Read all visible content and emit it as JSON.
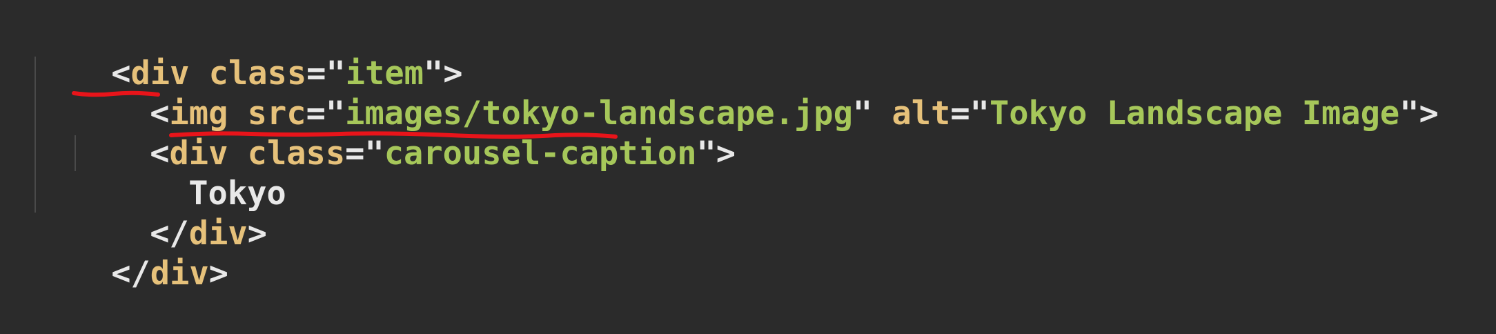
{
  "editor": {
    "line1": {
      "open": "<",
      "tag": "div",
      "attr": "class",
      "eq": "=",
      "q1": "\"",
      "value": "item",
      "q2": "\"",
      "close": ">"
    },
    "line2": {
      "open": "<",
      "tag": "img",
      "attr1": "src",
      "eq1": "=",
      "q1": "\"",
      "value1": "images/tokyo-landscape.jpg",
      "q2": "\"",
      "attr2": "alt",
      "eq2": "=",
      "q3": "\"",
      "value2": "Tokyo Landscape Image",
      "q4": "\"",
      "close": ">"
    },
    "line3": {
      "open": "<",
      "tag": "div",
      "attr": "class",
      "eq": "=",
      "q1": "\"",
      "value": "carousel-caption",
      "q2": "\"",
      "close": ">"
    },
    "line4": {
      "text": "Tokyo"
    },
    "line5": {
      "open": "</",
      "tag": "div",
      "close": ">"
    },
    "line6": {
      "open": "</",
      "tag": "div",
      "close": ">"
    }
  },
  "colors": {
    "background": "#2b2b2b",
    "tag": "#e6c17a",
    "string": "#a6c75a",
    "punctuation": "#e8e8e8",
    "annotation": "#e8141a",
    "indent_guide": "#4a4a4a"
  }
}
